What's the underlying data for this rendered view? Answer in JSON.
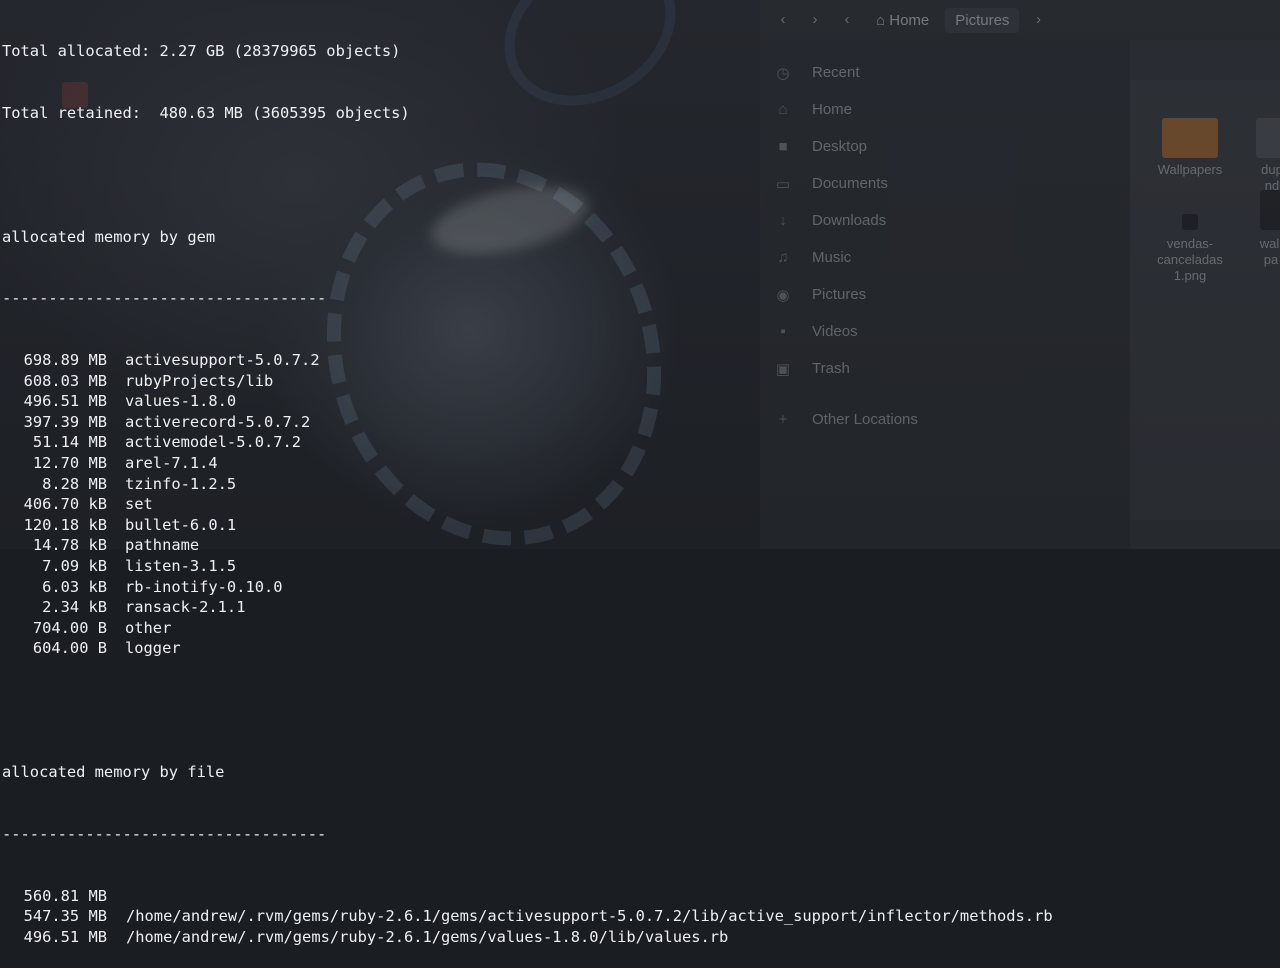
{
  "file_manager": {
    "nav": {
      "back_icon": "chevron-left-icon",
      "forward_icon": "chevron-right-icon",
      "path_icon": "chevron-left-icon",
      "next_icon": "chevron-right-icon"
    },
    "breadcrumb": {
      "home_label": "Home",
      "current_label": "Pictures"
    },
    "places": [
      {
        "label": "Recent",
        "icon": "clock-icon",
        "glyph": "◷"
      },
      {
        "label": "Home",
        "icon": "home-icon",
        "glyph": "⌂"
      },
      {
        "label": "Desktop",
        "icon": "folder-icon",
        "glyph": "■"
      },
      {
        "label": "Documents",
        "icon": "document-icon",
        "glyph": "▭"
      },
      {
        "label": "Downloads",
        "icon": "download-icon",
        "glyph": "↓"
      },
      {
        "label": "Music",
        "icon": "music-icon",
        "glyph": "♫"
      },
      {
        "label": "Pictures",
        "icon": "camera-icon",
        "glyph": "◉"
      },
      {
        "label": "Videos",
        "icon": "video-icon",
        "glyph": "▪"
      },
      {
        "label": "Trash",
        "icon": "trash-icon",
        "glyph": "▣"
      },
      {
        "label": "Other Locations",
        "icon": "plus-icon",
        "glyph": "+"
      }
    ],
    "tiles": [
      {
        "label": "Wallpapers"
      },
      {
        "label": "dup\nnd"
      },
      {
        "label": "vendas-\ncanceladas\n1.png"
      },
      {
        "label": "wall\npa"
      }
    ]
  },
  "terminal": {
    "total_allocated": "Total allocated: 2.27 GB (28379965 objects)",
    "total_retained": "Total retained:  480.63 MB (3605395 objects)",
    "gem_heading": "allocated memory by gem",
    "gem_rule": "-----------------------------------",
    "gems": [
      {
        "size": "698.89 MB",
        "name": "activesupport-5.0.7.2"
      },
      {
        "size": "608.03 MB",
        "name": "rubyProjects/lib"
      },
      {
        "size": "496.51 MB",
        "name": "values-1.8.0"
      },
      {
        "size": "397.39 MB",
        "name": "activerecord-5.0.7.2"
      },
      {
        "size": "51.14 MB",
        "name": "activemodel-5.0.7.2"
      },
      {
        "size": "12.70 MB",
        "name": "arel-7.1.4"
      },
      {
        "size": "8.28 MB",
        "name": "tzinfo-1.2.5"
      },
      {
        "size": "406.70 kB",
        "name": "set"
      },
      {
        "size": "120.18 kB",
        "name": "bullet-6.0.1"
      },
      {
        "size": "14.78 kB",
        "name": "pathname"
      },
      {
        "size": "7.09 kB",
        "name": "listen-3.1.5"
      },
      {
        "size": "6.03 kB",
        "name": "rb-inotify-0.10.0"
      },
      {
        "size": "2.34 kB",
        "name": "ransack-2.1.1"
      },
      {
        "size": "704.00 B",
        "name": "other"
      },
      {
        "size": "604.00 B",
        "name": "logger"
      }
    ],
    "file_heading": "allocated memory by file",
    "file_rule": "-----------------------------------",
    "files": [
      {
        "size": "560.81 MB",
        "path": ""
      },
      {
        "size": "547.35 MB",
        "path": "/home/andrew/.rvm/gems/ruby-2.6.1/gems/activesupport-5.0.7.2/lib/active_support/inflector/methods.rb"
      },
      {
        "size": "496.51 MB",
        "path": "/home/andrew/.rvm/gems/ruby-2.6.1/gems/values-1.8.0/lib/values.rb"
      }
    ]
  }
}
